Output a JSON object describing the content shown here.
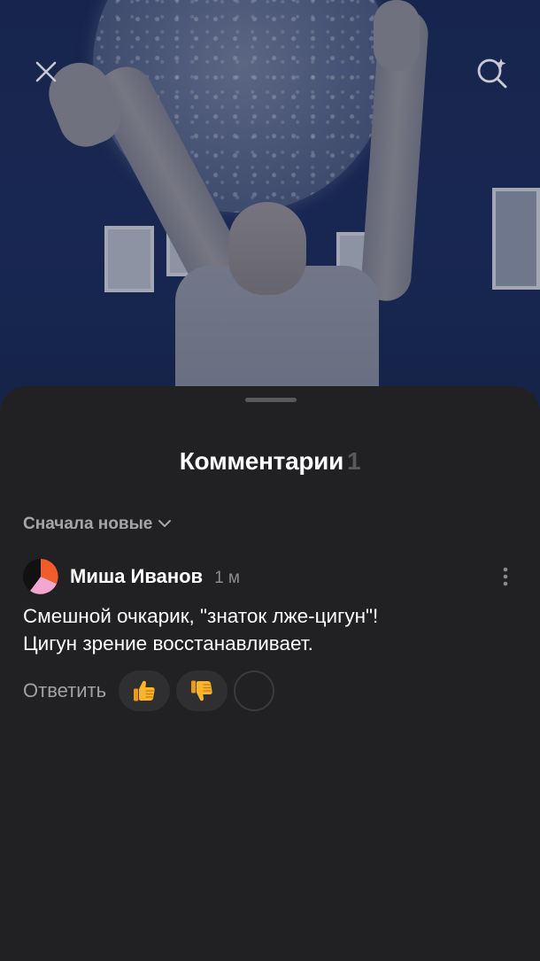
{
  "video": {
    "close_icon": "close-icon",
    "search_icon": "search-sparkle-icon"
  },
  "comments_sheet": {
    "title": "Комментарии",
    "count": "1",
    "sort_label": "Сначала новые",
    "sort_icon": "chevron-down-icon",
    "comments": [
      {
        "author": "Миша Иванов",
        "time": "1 м",
        "text_line1": "Смешной очкарик, \"знаток лже-цигун\"!",
        "text_line2": "Цигун зрение восстанавливает.",
        "reply_label": "Ответить",
        "reactions": [
          "thumbs-up-icon",
          "thumbs-down-icon",
          "add-reaction-icon"
        ],
        "more_icon": "more-vertical-icon"
      }
    ]
  },
  "colors": {
    "sheet_bg": "#212123",
    "secondary_text": "#a6a6a8",
    "avatar_orange": "#f25c2a",
    "avatar_pink": "#f3a7d0"
  }
}
